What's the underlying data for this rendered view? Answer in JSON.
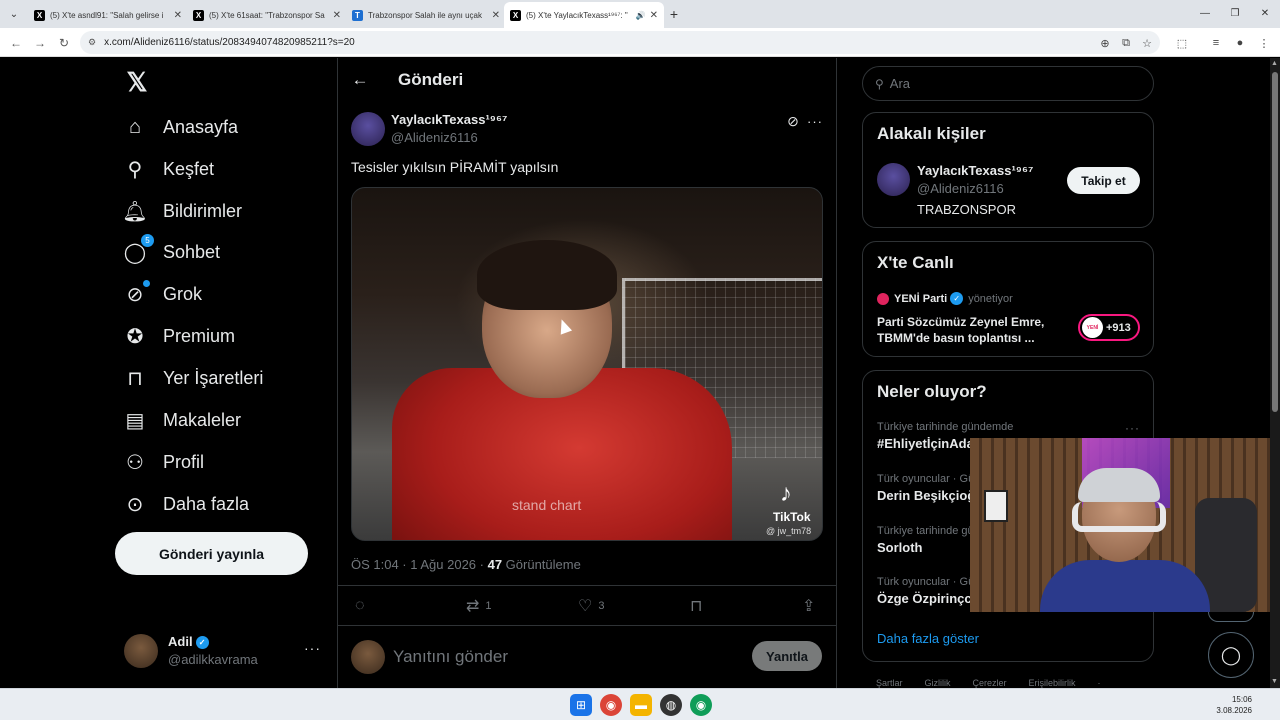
{
  "browser": {
    "tabs": [
      {
        "title": "(5) X'te asndl91: \"Salah gelirse i",
        "active": false
      },
      {
        "title": "(5) X'te 61saat: \"Trabzonspor Sa",
        "active": false
      },
      {
        "title": "Trabzonspor Salah ile aynı uçak",
        "active": false
      },
      {
        "title": "(5) X'te YaylacıkTexass¹⁹⁶⁷: \"",
        "active": true
      }
    ],
    "url": "x.com/Alideniz6116/status/2083494074820985211?s=20"
  },
  "sidebar": {
    "items": [
      {
        "label": "Anasayfa",
        "icon": "home-icon"
      },
      {
        "label": "Keşfet",
        "icon": "search-icon"
      },
      {
        "label": "Bildirimler",
        "icon": "bell-icon"
      },
      {
        "label": "Sohbet",
        "icon": "chat-icon",
        "badge": "5"
      },
      {
        "label": "Grok",
        "icon": "grok-icon"
      },
      {
        "label": "Premium",
        "icon": "premium-icon"
      },
      {
        "label": "Yer İşaretleri",
        "icon": "bookmark-icon"
      },
      {
        "label": "Makaleler",
        "icon": "articles-icon"
      },
      {
        "label": "Profil",
        "icon": "profile-icon"
      },
      {
        "label": "Daha fazla",
        "icon": "more-icon"
      }
    ],
    "post_button": "Gönderi yayınla",
    "account": {
      "name": "Adil",
      "handle": "@adilkkavrama"
    }
  },
  "main": {
    "title": "Gönderi",
    "tweet": {
      "author_name": "YaylacıkTexass¹⁹⁶⁷",
      "author_handle": "@Alideniz6116",
      "text": "Tesisler yıkılsın PİRAMİT yapılsın",
      "media_watermark": "TikTok",
      "media_watermark_user": "@ jw_tm78",
      "media_sponsor": "stand chart",
      "time": "ÖS 1:04 · 1 Ağu 2026 · ",
      "views_count": "47",
      "views_label": " Görüntüleme",
      "retweets": "1",
      "likes": "3"
    },
    "reply_placeholder": "Yanıtını gönder",
    "reply_button": "Yanıtla"
  },
  "right": {
    "search_placeholder": "Ara",
    "relevant": {
      "title": "Alakalı kişiler",
      "name": "YaylacıkTexass¹⁹⁶⁷",
      "handle": "@Alideniz6116",
      "bio": "TRABZONSPOR",
      "follow": "Takip et"
    },
    "live": {
      "title": "X'te Canlı",
      "host": "YENİ Parti",
      "role": "yönetiyor",
      "text": "Parti Sözcümüz Zeynel Emre, TBMM'de basın toplantısı ...",
      "avatar_text": "YENİ",
      "count": "+913"
    },
    "trends": {
      "title": "Neler oluyor?",
      "items": [
        {
          "context": "Türkiye tarihinde gündemde",
          "name": "#EhliyetİçinAda"
        },
        {
          "context": "Türk oyuncular · Gü",
          "name": "Derin Beşikçioğ"
        },
        {
          "context": "Türkiye tarihinde gü",
          "name": "Sorloth"
        },
        {
          "context": "Türk oyuncular · Gü",
          "name": "Özge Özpirinçci"
        }
      ],
      "show_more": "Daha fazla göster"
    },
    "footer": [
      "Şartlar",
      "Gizlilik",
      "Çerezler",
      "Erişilebilirlik",
      "·"
    ]
  },
  "taskbar": {
    "time": "15:06",
    "date": "3.08.2026"
  },
  "colors": {
    "accent": "#1d9bf0",
    "background": "#000000",
    "text": "#e7e9ea",
    "muted": "#71767b",
    "border": "#2f3336"
  }
}
